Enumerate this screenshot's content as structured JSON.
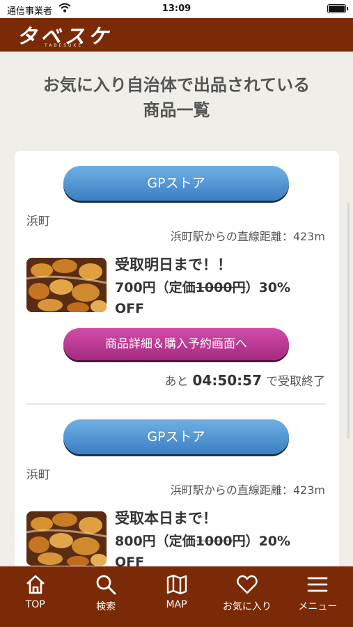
{
  "status_bar": {
    "carrier": "通信事業者",
    "time": "13:09"
  },
  "header": {
    "logo": "タベスケ",
    "logo_sub": "TABESUKE"
  },
  "page": {
    "title_line1": "お気に入り自治体で出品されている",
    "title_line2": "商品一覧"
  },
  "listings": [
    {
      "store_label": "GPストア",
      "town": "浜町",
      "distance": "浜町駅からの直線距離：423m",
      "heading": "受取明日まで！！",
      "price": "700円",
      "list_price_open": "（定価",
      "list_price": "1000円",
      "list_price_close": "）30%",
      "discount": "OFF",
      "detail_label": "商品詳細＆購入予約画面へ",
      "countdown_prefix": "あと",
      "countdown_time": "04:50:57",
      "countdown_suffix": "で受取終了"
    },
    {
      "store_label": "GPストア",
      "town": "浜町",
      "distance": "浜町駅からの直線距離：423m",
      "heading": "受取本日まで！",
      "price": "800円",
      "list_price_open": "（定価",
      "list_price": "1000円",
      "list_price_close": "）20%",
      "discount": "OFF"
    }
  ],
  "tab_bar": {
    "items": [
      {
        "label": "TOP",
        "icon": "home-icon"
      },
      {
        "label": "検索",
        "icon": "search-icon"
      },
      {
        "label": "MAP",
        "icon": "map-icon"
      },
      {
        "label": "お気に入り",
        "icon": "heart-icon"
      },
      {
        "label": "メニュー",
        "icon": "menu-icon"
      }
    ]
  },
  "colors": {
    "brand": "#7a2a06",
    "store_button": "#4a8fd0",
    "detail_button": "#c03d98",
    "background": "#efeee8"
  }
}
